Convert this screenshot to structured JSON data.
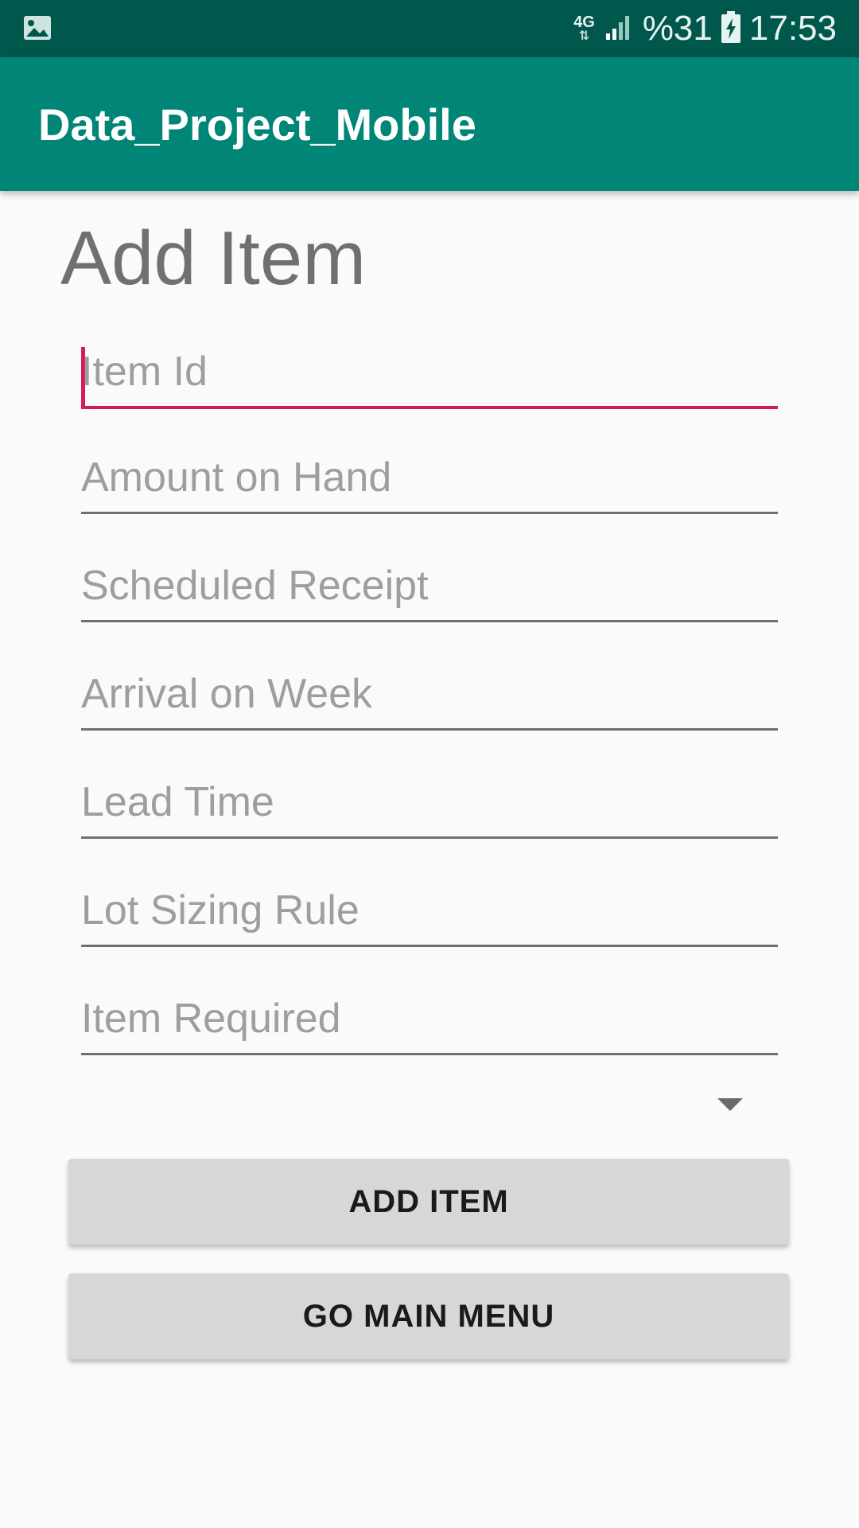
{
  "status_bar": {
    "network": "4G",
    "battery": "%31",
    "time": "17:53",
    "icons": [
      "image-icon",
      "network-arrows-icon",
      "signal-icon",
      "battery-charging-icon"
    ]
  },
  "app_bar": {
    "title": "Data_Project_Mobile",
    "color": "#008577"
  },
  "page": {
    "heading": "Add Item"
  },
  "form": {
    "fields": [
      {
        "placeholder": "Item Id",
        "value": ""
      },
      {
        "placeholder": "Amount on Hand",
        "value": ""
      },
      {
        "placeholder": "Scheduled Receipt",
        "value": ""
      },
      {
        "placeholder": "Arrival on Week",
        "value": ""
      },
      {
        "placeholder": "Lead Time",
        "value": ""
      },
      {
        "placeholder": "Lot Sizing Rule",
        "value": ""
      },
      {
        "placeholder": "Item Required",
        "value": ""
      }
    ],
    "spinner": {
      "selected": "",
      "icon": "dropdown-arrow-icon"
    },
    "accent_color": "#d81b60"
  },
  "buttons": {
    "add_item": "ADD ITEM",
    "go_main_menu": "GO MAIN MENU"
  }
}
